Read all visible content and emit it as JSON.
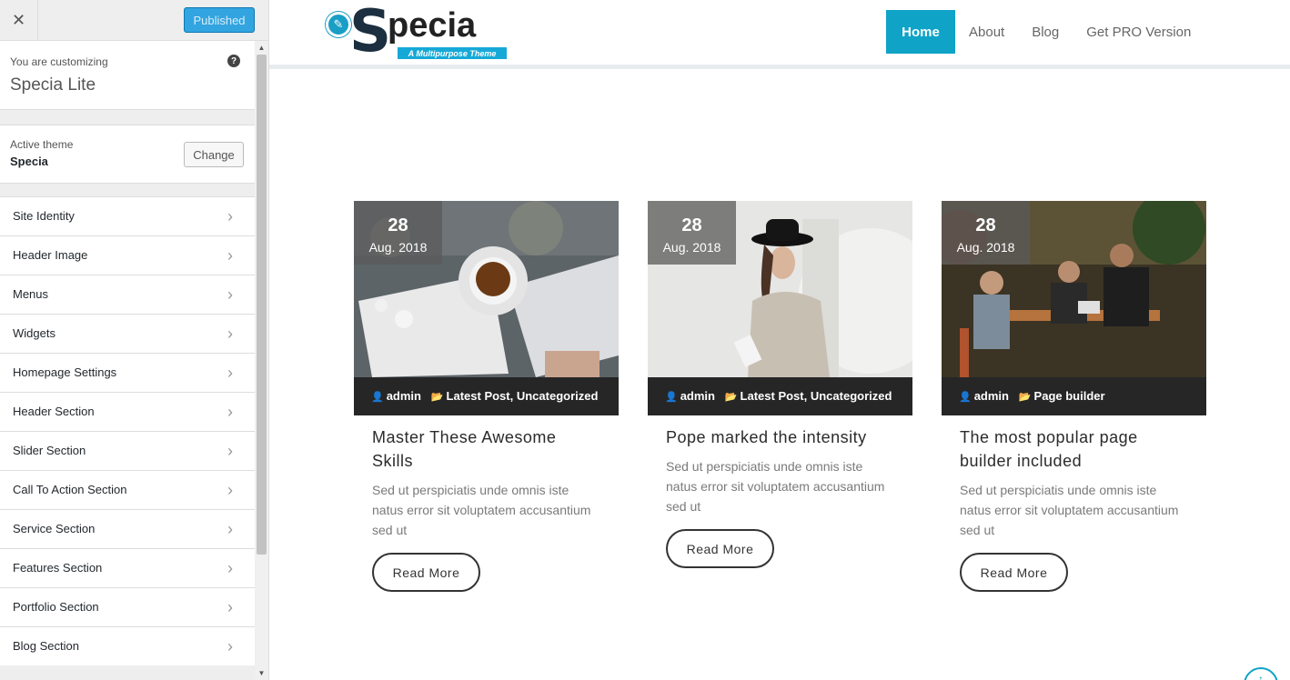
{
  "customizer": {
    "publish_label": "Published",
    "close_glyph": "✕",
    "customizing_label": "You are customizing",
    "site_name": "Specia Lite",
    "active_theme_label": "Active theme",
    "theme_name": "Specia",
    "change_label": "Change",
    "menu": [
      {
        "label": "Site Identity"
      },
      {
        "label": "Header Image"
      },
      {
        "label": "Menus"
      },
      {
        "label": "Widgets"
      },
      {
        "label": "Homepage Settings"
      },
      {
        "label": "Header Section"
      },
      {
        "label": "Slider Section"
      },
      {
        "label": "Call To Action Section"
      },
      {
        "label": "Service Section"
      },
      {
        "label": "Features Section"
      },
      {
        "label": "Portfolio Section"
      },
      {
        "label": "Blog Section"
      }
    ]
  },
  "site": {
    "logo_text": "pecia",
    "logo_letter": "S",
    "tagline": "A Multipurpose Theme",
    "nav": [
      {
        "label": "Home",
        "active": true
      },
      {
        "label": "About"
      },
      {
        "label": "Blog"
      },
      {
        "label": "Get PRO Version"
      }
    ]
  },
  "posts": [
    {
      "day": "28",
      "month": "Aug. 2018",
      "author": "admin",
      "categories": "Latest Post, Uncategorized",
      "title": "Master These Awesome Skills",
      "excerpt": "Sed ut perspiciatis unde omnis iste natus error sit voluptatem accusantium sed ut",
      "button": "Read More"
    },
    {
      "day": "28",
      "month": "Aug. 2018",
      "author": "admin",
      "categories": "Latest Post, Uncategorized",
      "title": "Pope marked the intensity",
      "excerpt": "Sed ut perspiciatis unde omnis iste natus error sit voluptatem accusantium sed ut",
      "button": "Read More"
    },
    {
      "day": "28",
      "month": "Aug. 2018",
      "author": "admin",
      "categories": "Page builder",
      "title": "The most popular page builder included",
      "excerpt": "Sed ut perspiciatis unde omnis iste natus error sit voluptatem accusantium sed ut",
      "button": "Read More"
    }
  ],
  "colors": {
    "accent": "#0ea3c7",
    "publish_button": "#32a4e0",
    "meta_bar": "#262626"
  }
}
